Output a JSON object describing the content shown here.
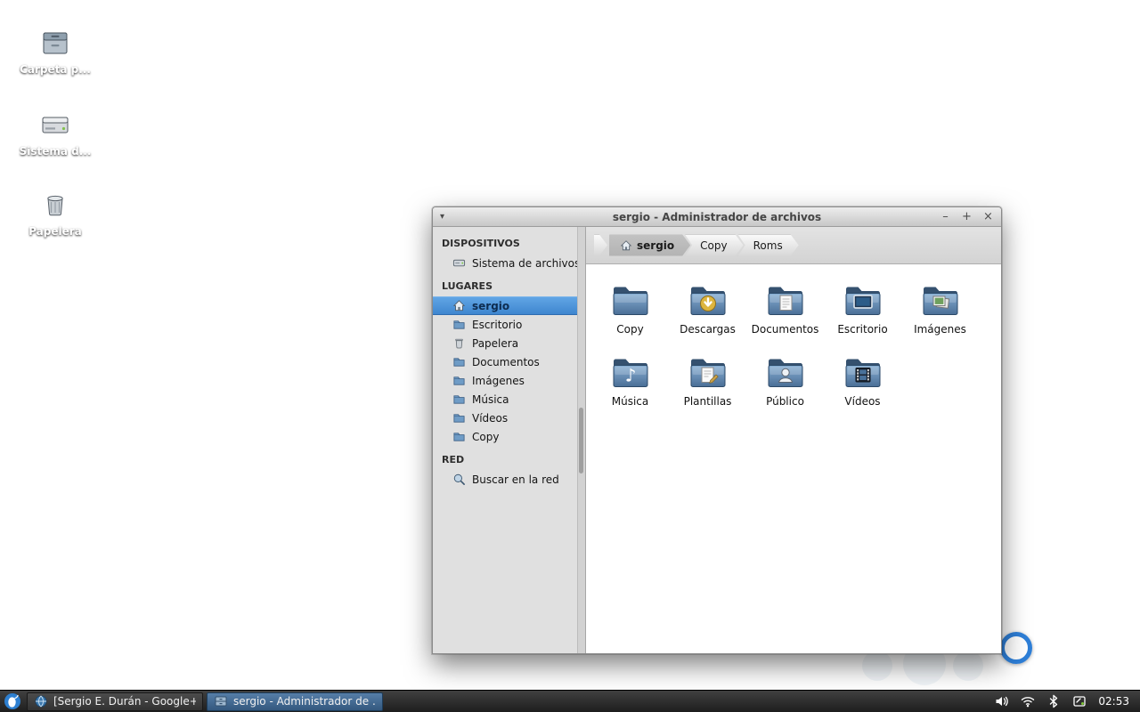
{
  "desktop": {
    "icons": [
      {
        "label": "Carpeta p...",
        "icon": "home-folder-icon"
      },
      {
        "label": "Sistema d...",
        "icon": "filesystem-drive-icon"
      },
      {
        "label": "Papelera",
        "icon": "trash-icon"
      }
    ]
  },
  "window": {
    "title": "sergio - Administrador de archivos",
    "controls": {
      "minimize": "–",
      "maximize": "+",
      "close": "×"
    },
    "sidebar": {
      "sections": [
        {
          "header": "DISPOSITIVOS",
          "items": [
            {
              "label": "Sistema de archivos",
              "icon": "drive-icon",
              "selected": false
            }
          ]
        },
        {
          "header": "LUGARES",
          "items": [
            {
              "label": "sergio",
              "icon": "home-icon",
              "selected": true
            },
            {
              "label": "Escritorio",
              "icon": "folder-icon",
              "selected": false
            },
            {
              "label": "Papelera",
              "icon": "trash-icon",
              "selected": false
            },
            {
              "label": "Documentos",
              "icon": "folder-icon",
              "selected": false
            },
            {
              "label": "Imágenes",
              "icon": "folder-icon",
              "selected": false
            },
            {
              "label": "Música",
              "icon": "folder-icon",
              "selected": false
            },
            {
              "label": "Vídeos",
              "icon": "folder-icon",
              "selected": false
            },
            {
              "label": "Copy",
              "icon": "folder-icon",
              "selected": false
            }
          ]
        },
        {
          "header": "RED",
          "items": [
            {
              "label": "Buscar en la red",
              "icon": "network-search-icon",
              "selected": false
            }
          ]
        }
      ]
    },
    "breadcrumbs": [
      {
        "label": "sergio",
        "active": true
      },
      {
        "label": "Copy",
        "active": false
      },
      {
        "label": "Roms",
        "active": false
      }
    ],
    "files": [
      {
        "label": "Copy",
        "emblem": "plain"
      },
      {
        "label": "Descargas",
        "emblem": "download"
      },
      {
        "label": "Documentos",
        "emblem": "document"
      },
      {
        "label": "Escritorio",
        "emblem": "desktop"
      },
      {
        "label": "Imágenes",
        "emblem": "images"
      },
      {
        "label": "Música",
        "emblem": "music"
      },
      {
        "label": "Plantillas",
        "emblem": "template"
      },
      {
        "label": "Público",
        "emblem": "person"
      },
      {
        "label": "Vídeos",
        "emblem": "film"
      }
    ]
  },
  "taskbar": {
    "windows": [
      {
        "label": "[Sergio E. Durán - Google+ ...",
        "active": false
      },
      {
        "label": "sergio - Administrador de ...",
        "active": true
      }
    ],
    "clock": "02:53"
  },
  "colors": {
    "selection_blue": "#4a90d2",
    "panel_dark": "#2b2b2b",
    "desktop_top": "#33678e",
    "desktop_bottom": "#14304a",
    "ring_blue": "#2e7fd8",
    "download_badge": "#ddb53e"
  }
}
